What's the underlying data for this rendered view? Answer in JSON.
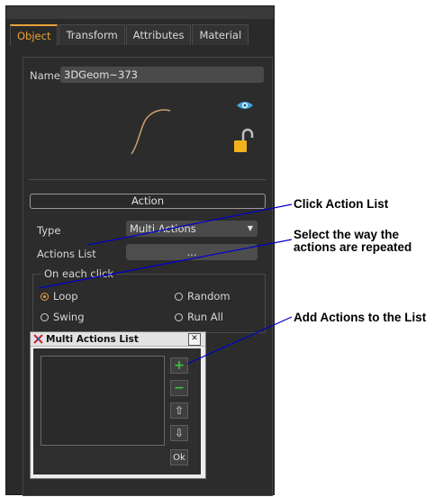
{
  "tabs": [
    "Object",
    "Transform",
    "Attributes",
    "Material"
  ],
  "name_label": "Name",
  "name_value": "3DGeom~373",
  "action_header": "Action",
  "type_label": "Type",
  "type_value": "Multi Actions",
  "actions_list_label": "Actions List",
  "actions_list_button": "...",
  "group_label": "On each click",
  "radios": {
    "loop": "Loop",
    "random": "Random",
    "swing": "Swing",
    "run_all": "Run All",
    "selected": "Loop"
  },
  "dialog": {
    "title": "Multi Actions List",
    "close": "✕",
    "add": "+",
    "remove": "−",
    "up": "⇧",
    "down": "⇩",
    "ok": "Ok"
  },
  "callouts": {
    "c1": "Click Action List",
    "c2_line1": "Select the way the",
    "c2_line2": "actions are repeated",
    "c3": "Add Actions to the List"
  },
  "colors": {
    "accent": "#e8a23a",
    "eye": "#3fa8e0",
    "lock": "#f2b21b",
    "plus": "#3ec43e",
    "minus": "#3ec43e",
    "dialog_icon": "#c8232c",
    "annotation_line": "#0000cc"
  }
}
